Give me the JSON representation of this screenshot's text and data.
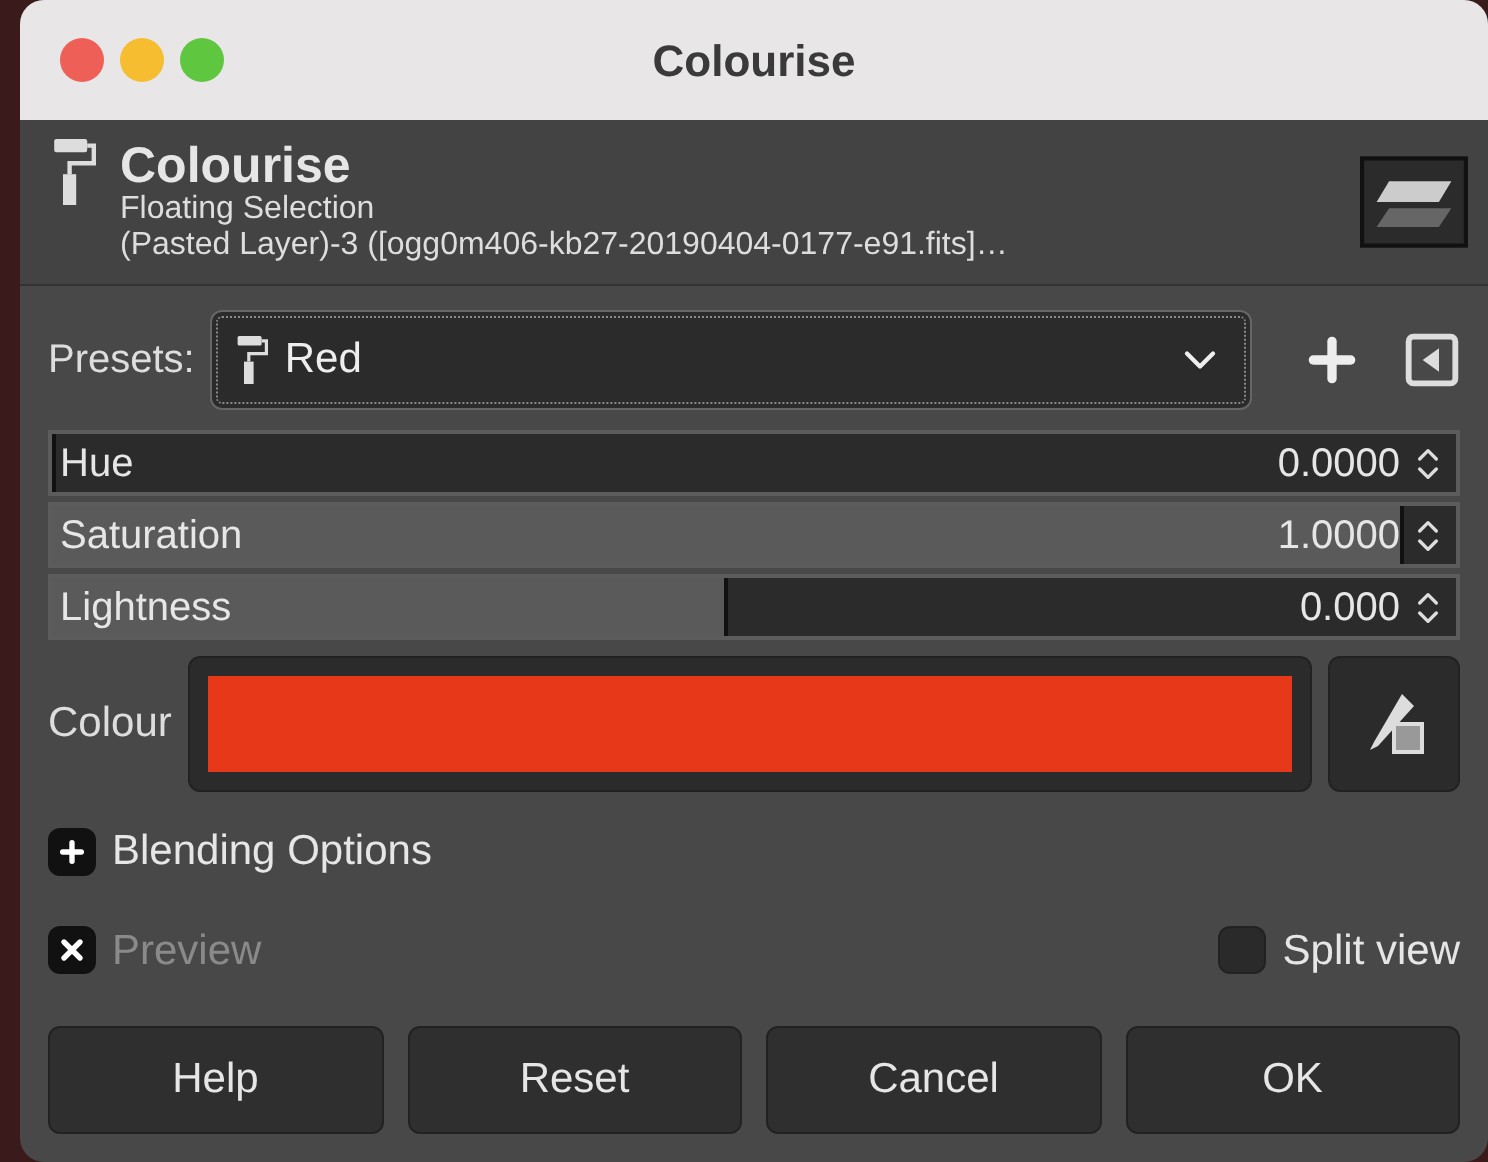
{
  "window": {
    "title": "Colourise"
  },
  "header": {
    "title": "Colourise",
    "subtitle": "Floating Selection",
    "detail": "(Pasted Layer)-3 ([ogg0m406-kb27-20190404-0177-e91.fits]…"
  },
  "presets": {
    "label": "Presets:",
    "value": "Red"
  },
  "sliders": [
    {
      "label": "Hue",
      "value": "0.0000",
      "level": 0
    },
    {
      "label": "Saturation",
      "value": "1.0000",
      "level": 1
    },
    {
      "label": "Lightness",
      "value": "0.000",
      "level": 0.5
    }
  ],
  "colour": {
    "label": "Colour",
    "color": "#e8381a"
  },
  "blending": {
    "label": "Blending Options",
    "expanded": false
  },
  "preview": {
    "label": "Preview",
    "checked": true,
    "disabled": true
  },
  "split_view": {
    "label": "Split view",
    "checked": false
  },
  "buttons": [
    "Help",
    "Reset",
    "Cancel",
    "OK"
  ]
}
